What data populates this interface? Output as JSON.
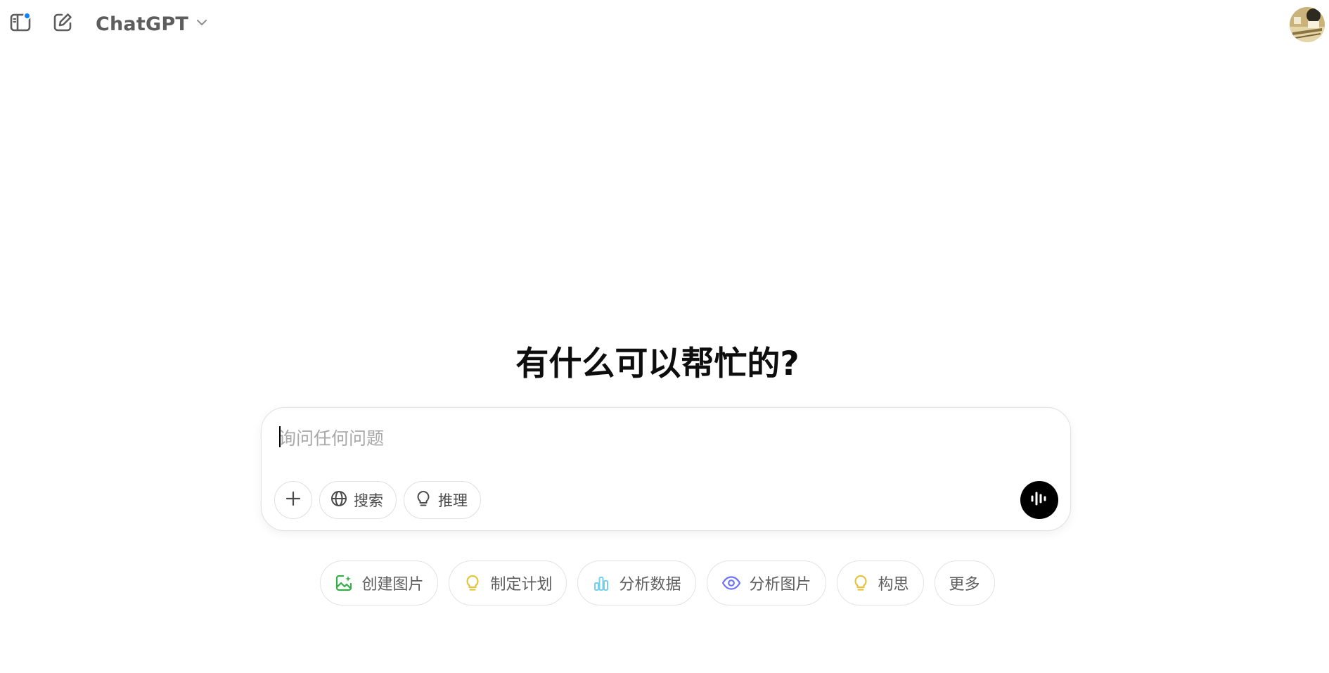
{
  "header": {
    "model_name": "ChatGPT",
    "icons": {
      "sidebar_toggle": "sidebar-toggle-icon",
      "new_chat": "edit-icon",
      "model_dropdown": "chevron-down-icon",
      "avatar": "user-avatar"
    },
    "notification_dot_color": "#0a84ff"
  },
  "main": {
    "headline": "有什么可以帮忙的?"
  },
  "composer": {
    "placeholder": "询问任何问题",
    "value": "",
    "tools": [
      {
        "label": "搜索",
        "icon": "globe-icon"
      },
      {
        "label": "推理",
        "icon": "lightbulb-icon"
      }
    ],
    "attach_icon": "plus-icon",
    "voice_icon": "voice-wave-icon",
    "voice_button_color": "#000000"
  },
  "suggestions": [
    {
      "label": "创建图片",
      "icon": "image-create-icon",
      "color": "#35ae47"
    },
    {
      "label": "制定计划",
      "icon": "lightbulb-icon",
      "color": "#e2c541"
    },
    {
      "label": "分析数据",
      "icon": "bar-chart-icon",
      "color": "#76d0eb"
    },
    {
      "label": "分析图片",
      "icon": "eye-icon",
      "color": "#6c71ff"
    },
    {
      "label": "构思",
      "icon": "lightbulb-icon",
      "color": "#e2c541"
    },
    {
      "label": "更多",
      "icon": "",
      "color": ""
    }
  ]
}
